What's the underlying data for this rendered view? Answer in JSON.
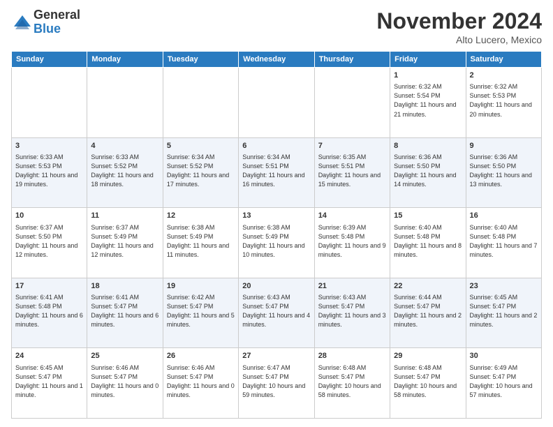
{
  "header": {
    "logo_line1": "General",
    "logo_line2": "Blue",
    "month_title": "November 2024",
    "location": "Alto Lucero, Mexico"
  },
  "weekdays": [
    "Sunday",
    "Monday",
    "Tuesday",
    "Wednesday",
    "Thursday",
    "Friday",
    "Saturday"
  ],
  "weeks": [
    [
      {
        "day": "",
        "info": ""
      },
      {
        "day": "",
        "info": ""
      },
      {
        "day": "",
        "info": ""
      },
      {
        "day": "",
        "info": ""
      },
      {
        "day": "",
        "info": ""
      },
      {
        "day": "1",
        "info": "Sunrise: 6:32 AM\nSunset: 5:54 PM\nDaylight: 11 hours and 21 minutes."
      },
      {
        "day": "2",
        "info": "Sunrise: 6:32 AM\nSunset: 5:53 PM\nDaylight: 11 hours and 20 minutes."
      }
    ],
    [
      {
        "day": "3",
        "info": "Sunrise: 6:33 AM\nSunset: 5:53 PM\nDaylight: 11 hours and 19 minutes."
      },
      {
        "day": "4",
        "info": "Sunrise: 6:33 AM\nSunset: 5:52 PM\nDaylight: 11 hours and 18 minutes."
      },
      {
        "day": "5",
        "info": "Sunrise: 6:34 AM\nSunset: 5:52 PM\nDaylight: 11 hours and 17 minutes."
      },
      {
        "day": "6",
        "info": "Sunrise: 6:34 AM\nSunset: 5:51 PM\nDaylight: 11 hours and 16 minutes."
      },
      {
        "day": "7",
        "info": "Sunrise: 6:35 AM\nSunset: 5:51 PM\nDaylight: 11 hours and 15 minutes."
      },
      {
        "day": "8",
        "info": "Sunrise: 6:36 AM\nSunset: 5:50 PM\nDaylight: 11 hours and 14 minutes."
      },
      {
        "day": "9",
        "info": "Sunrise: 6:36 AM\nSunset: 5:50 PM\nDaylight: 11 hours and 13 minutes."
      }
    ],
    [
      {
        "day": "10",
        "info": "Sunrise: 6:37 AM\nSunset: 5:50 PM\nDaylight: 11 hours and 12 minutes."
      },
      {
        "day": "11",
        "info": "Sunrise: 6:37 AM\nSunset: 5:49 PM\nDaylight: 11 hours and 12 minutes."
      },
      {
        "day": "12",
        "info": "Sunrise: 6:38 AM\nSunset: 5:49 PM\nDaylight: 11 hours and 11 minutes."
      },
      {
        "day": "13",
        "info": "Sunrise: 6:38 AM\nSunset: 5:49 PM\nDaylight: 11 hours and 10 minutes."
      },
      {
        "day": "14",
        "info": "Sunrise: 6:39 AM\nSunset: 5:48 PM\nDaylight: 11 hours and 9 minutes."
      },
      {
        "day": "15",
        "info": "Sunrise: 6:40 AM\nSunset: 5:48 PM\nDaylight: 11 hours and 8 minutes."
      },
      {
        "day": "16",
        "info": "Sunrise: 6:40 AM\nSunset: 5:48 PM\nDaylight: 11 hours and 7 minutes."
      }
    ],
    [
      {
        "day": "17",
        "info": "Sunrise: 6:41 AM\nSunset: 5:48 PM\nDaylight: 11 hours and 6 minutes."
      },
      {
        "day": "18",
        "info": "Sunrise: 6:41 AM\nSunset: 5:47 PM\nDaylight: 11 hours and 6 minutes."
      },
      {
        "day": "19",
        "info": "Sunrise: 6:42 AM\nSunset: 5:47 PM\nDaylight: 11 hours and 5 minutes."
      },
      {
        "day": "20",
        "info": "Sunrise: 6:43 AM\nSunset: 5:47 PM\nDaylight: 11 hours and 4 minutes."
      },
      {
        "day": "21",
        "info": "Sunrise: 6:43 AM\nSunset: 5:47 PM\nDaylight: 11 hours and 3 minutes."
      },
      {
        "day": "22",
        "info": "Sunrise: 6:44 AM\nSunset: 5:47 PM\nDaylight: 11 hours and 2 minutes."
      },
      {
        "day": "23",
        "info": "Sunrise: 6:45 AM\nSunset: 5:47 PM\nDaylight: 11 hours and 2 minutes."
      }
    ],
    [
      {
        "day": "24",
        "info": "Sunrise: 6:45 AM\nSunset: 5:47 PM\nDaylight: 11 hours and 1 minute."
      },
      {
        "day": "25",
        "info": "Sunrise: 6:46 AM\nSunset: 5:47 PM\nDaylight: 11 hours and 0 minutes."
      },
      {
        "day": "26",
        "info": "Sunrise: 6:46 AM\nSunset: 5:47 PM\nDaylight: 11 hours and 0 minutes."
      },
      {
        "day": "27",
        "info": "Sunrise: 6:47 AM\nSunset: 5:47 PM\nDaylight: 10 hours and 59 minutes."
      },
      {
        "day": "28",
        "info": "Sunrise: 6:48 AM\nSunset: 5:47 PM\nDaylight: 10 hours and 58 minutes."
      },
      {
        "day": "29",
        "info": "Sunrise: 6:48 AM\nSunset: 5:47 PM\nDaylight: 10 hours and 58 minutes."
      },
      {
        "day": "30",
        "info": "Sunrise: 6:49 AM\nSunset: 5:47 PM\nDaylight: 10 hours and 57 minutes."
      }
    ]
  ]
}
